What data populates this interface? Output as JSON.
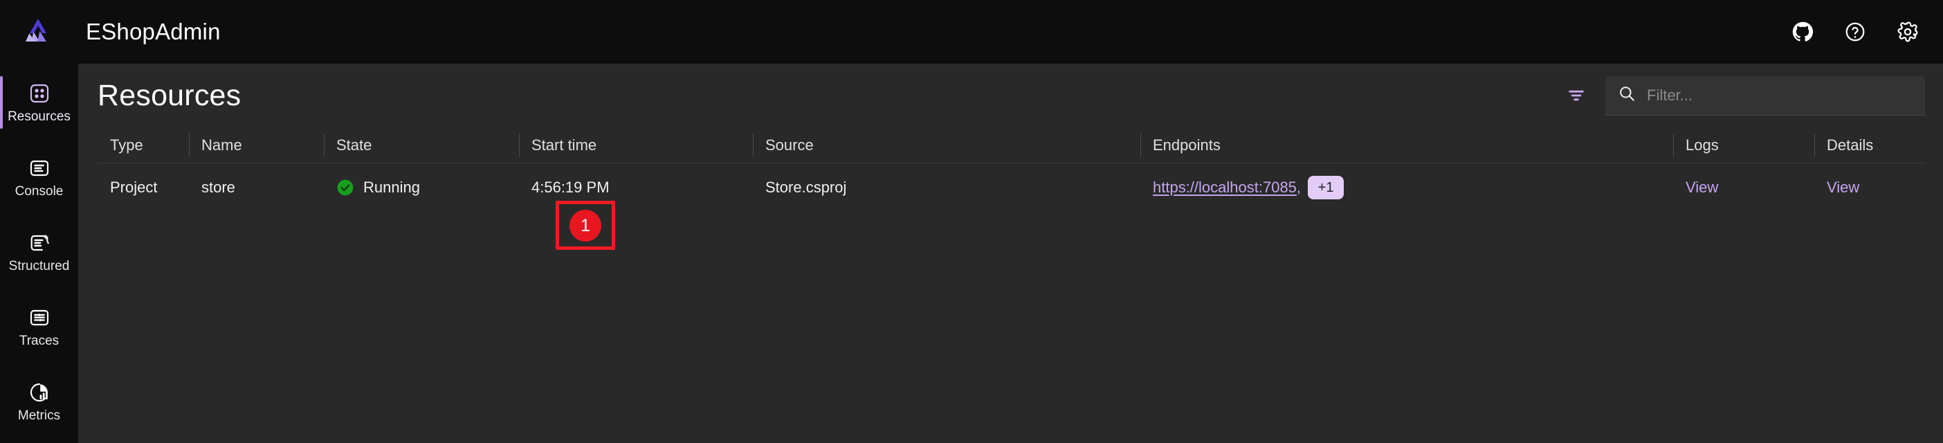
{
  "header": {
    "app_title": "EShopAdmin",
    "logo_icon": "aspire-logo-icon",
    "actions": [
      {
        "name": "github-icon",
        "label": "GitHub"
      },
      {
        "name": "help-icon",
        "label": "Help"
      },
      {
        "name": "settings-gear-icon",
        "label": "Settings"
      }
    ]
  },
  "sidebar": {
    "items": [
      {
        "label": "Resources",
        "icon": "resources-grid-icon",
        "active": true
      },
      {
        "label": "Console",
        "icon": "console-lines-icon",
        "active": false
      },
      {
        "label": "Structured",
        "icon": "structured-logs-icon",
        "active": false
      },
      {
        "label": "Traces",
        "icon": "traces-icon",
        "active": false
      },
      {
        "label": "Metrics",
        "icon": "metrics-pie-icon",
        "active": false
      }
    ]
  },
  "main": {
    "page_title": "Resources",
    "filter_icon": "filter-icon",
    "search": {
      "icon": "search-icon",
      "placeholder": "Filter...",
      "value": ""
    },
    "table": {
      "columns": [
        "Type",
        "Name",
        "State",
        "Start time",
        "Source",
        "Endpoints",
        "Logs",
        "Details"
      ],
      "rows": [
        {
          "type": "Project",
          "name": "store",
          "state": "Running",
          "state_icon": "status-running-check-icon",
          "start_time": "4:56:19 PM",
          "source": "Store.csproj",
          "endpoint_url": "https://localhost:7085",
          "endpoint_separator": ",",
          "endpoint_more_badge": "+1",
          "logs_link": "View",
          "details_link": "View"
        }
      ]
    }
  },
  "annotations": [
    {
      "id": "1",
      "badge": "1",
      "target": "state-cell-running-badge"
    }
  ],
  "colors": {
    "page_background": "#0d0d0d",
    "panel_background": "#292929",
    "accent_purple": "#c3a6ee",
    "badge_purple": "#e3cdf7",
    "running_green": "#16a01e",
    "annotation_red": "#ef1b24",
    "text_primary": "#f0f0f0",
    "text_muted": "#8b8b8b"
  }
}
